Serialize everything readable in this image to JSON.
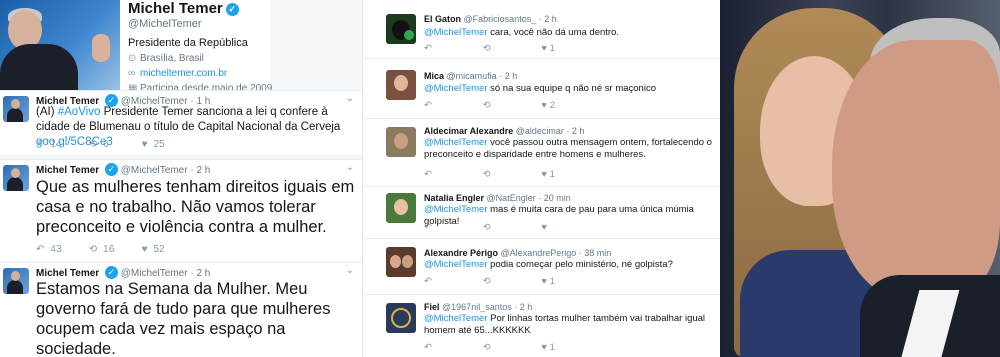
{
  "profile": {
    "name": "Michel Temer",
    "handle": "@MichelTemer",
    "bio": "Presidente da República",
    "location": "Brasília, Brasil",
    "website": "micheltemer.com.br",
    "joined": "Participa desde maio de 2009"
  },
  "tweets": [
    {
      "name": "Michel Temer",
      "handle": "@MichelTemer",
      "time": "· 1 h",
      "text_pre": "(AI) ",
      "hashtag": "#AoVivo",
      "text_mid": " Presidente Temer sanciona a lei q confere à cidade de Blumenau o título de Capital Nacional da Cerveja ",
      "link": "goo.gl/5C8Ce3",
      "replies": "14",
      "retweets": "6",
      "likes": "25"
    },
    {
      "name": "Michel Temer",
      "handle": "@MichelTemer",
      "time": "· 2 h",
      "text": "Que as mulheres tenham direitos iguais em casa e no trabalho. Não vamos tolerar preconceito e violência contra a mulher.",
      "replies": "43",
      "retweets": "16",
      "likes": "52"
    },
    {
      "name": "Michel Temer",
      "handle": "@MichelTemer",
      "time": "· 2 h",
      "text": "Estamos na Semana da Mulher. Meu governo fará de tudo para que mulheres ocupem cada vez mais espaço na sociedade."
    }
  ],
  "replies": [
    {
      "name": "El Gaton",
      "handle": "@Fabriciosantos_",
      "time": "· 2 h",
      "mention": "@MichelTemer",
      "text": " cara, você não dá uma dentro.",
      "likes": "1"
    },
    {
      "name": "Mica",
      "handle": "@micamufia",
      "time": "· 2 h",
      "mention": "@MichelTemer",
      "text": " só na sua equipe q não né sr maçonico",
      "likes": "2"
    },
    {
      "name": "Aldecimar Alexandre",
      "handle": "@aldecimar",
      "time": "· 2 h",
      "mention": "@MichelTemer",
      "text": " você passou outra mensagem ontem, fortalecendo o preconceito e disparidade entre homens e mulheres.",
      "likes": "1"
    },
    {
      "name": "Natalia Engler",
      "handle": "@NatEngler",
      "time": "· 20 min",
      "mention": "@MichelTemer",
      "text": " mas é muita cara de pau para uma única múmia golpista!",
      "likes": ""
    },
    {
      "name": "Alexandre Périgo",
      "handle": "@AlexandrePerigo",
      "time": "· 38 min",
      "mention": "@MichelTemer",
      "text": " podia começar pelo ministério, né golpista?",
      "likes": "1"
    },
    {
      "name": "Fiel",
      "handle": "@1967nil_santos",
      "time": "· 2 h",
      "mention": "@MichelTemer",
      "text": " Por linhas tortas mulher também vai trabalhar igual homem até 65...KKKKKK",
      "likes": "1"
    }
  ],
  "icons": {
    "reply": "↶",
    "retweet": "⟲",
    "like": "♥",
    "chevron": "⌄",
    "verified": "✓",
    "location": "⊙",
    "link": "🔗",
    "calendar": "▦"
  }
}
